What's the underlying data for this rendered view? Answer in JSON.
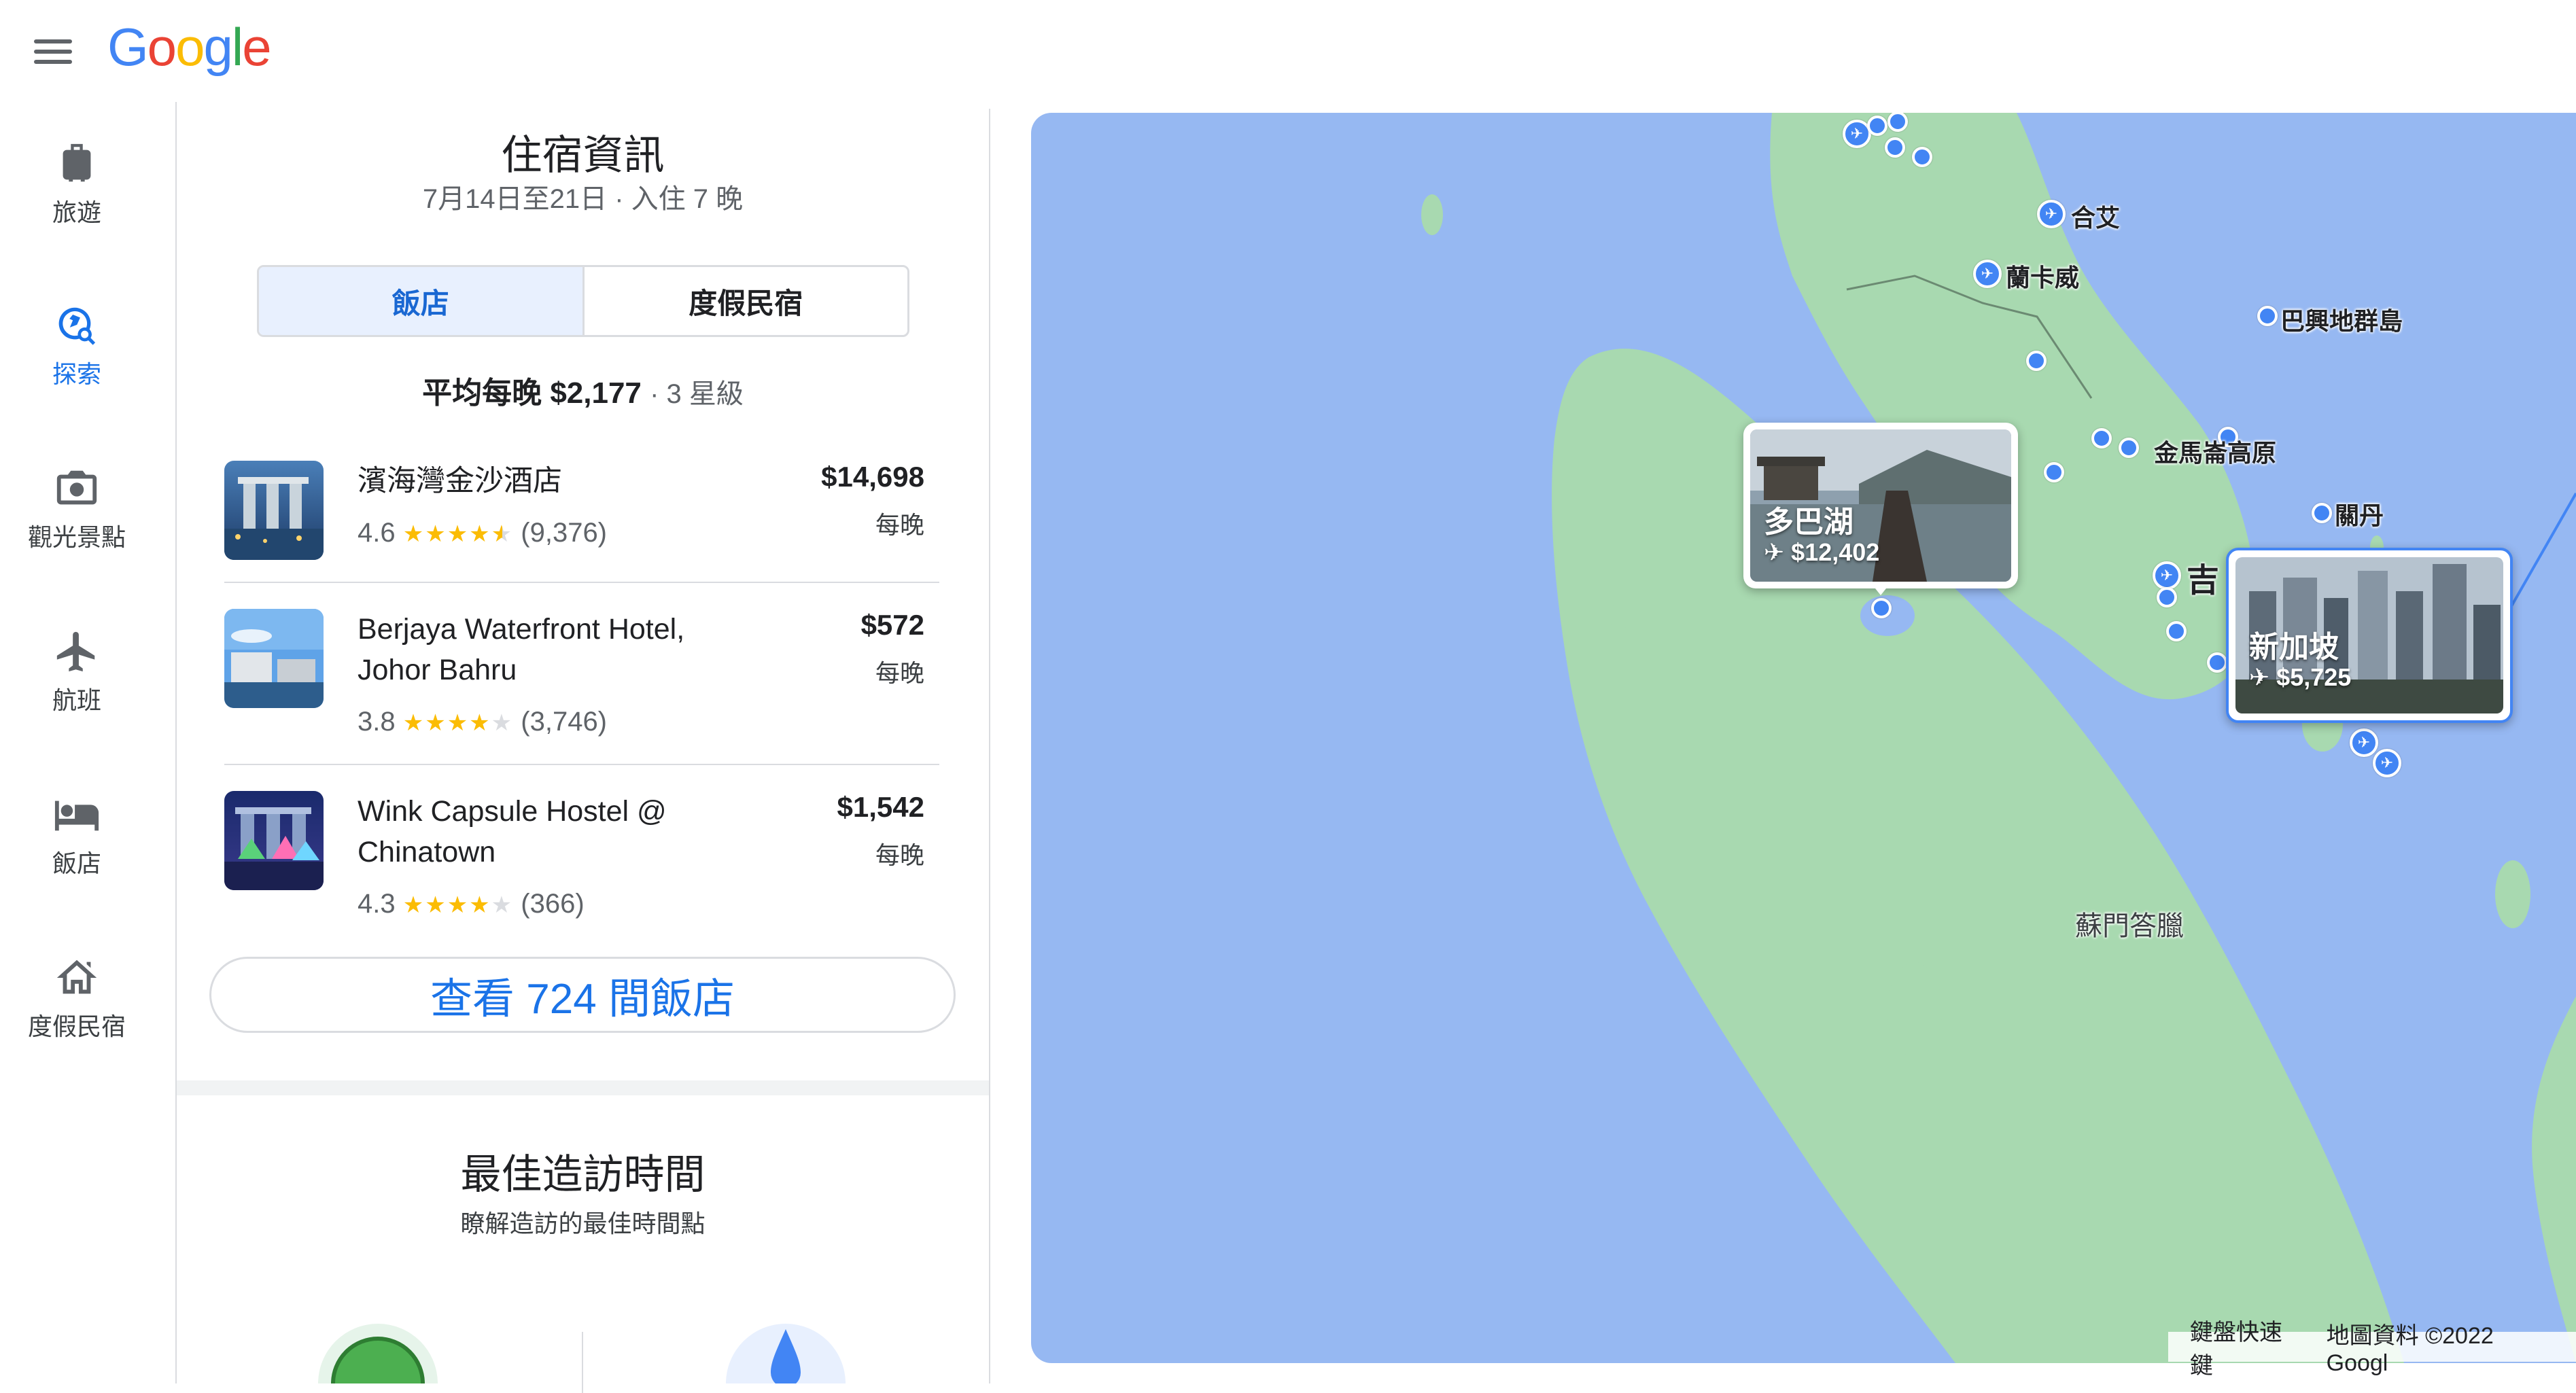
{
  "app": {
    "logo": "Google",
    "logo_colors": [
      "#4285F4",
      "#EA4335",
      "#FBBC05",
      "#4285F4",
      "#34A853",
      "#EA4335"
    ]
  },
  "nav": {
    "items": [
      {
        "label": "旅遊",
        "icon": "luggage-icon",
        "active": false
      },
      {
        "label": "探索",
        "icon": "explore-icon",
        "active": true
      },
      {
        "label": "觀光景點",
        "icon": "camera-icon",
        "active": false
      },
      {
        "label": "航班",
        "icon": "airplane-icon",
        "active": false
      },
      {
        "label": "飯店",
        "icon": "bed-icon",
        "active": false
      },
      {
        "label": "度假民宿",
        "icon": "house-icon",
        "active": false
      }
    ]
  },
  "lodging": {
    "title": "住宿資訊",
    "dates": "7月14日至21日 · 入住 7 晚",
    "tabs": [
      {
        "label": "飯店",
        "active": true
      },
      {
        "label": "度假民宿",
        "active": false
      }
    ],
    "avg_label": "平均每晚",
    "avg_price": "$2,177",
    "avg_class": "· 3 星級",
    "hotels": [
      {
        "name": "濱海灣金沙酒店",
        "rating": "4.6",
        "stars": 4.5,
        "reviews": "(9,376)",
        "price": "$14,698",
        "per": "每晚"
      },
      {
        "name": "Berjaya Waterfront Hotel, Johor Bahru",
        "rating": "3.8",
        "stars": 4,
        "reviews": "(3,746)",
        "price": "$572",
        "per": "每晚"
      },
      {
        "name": "Wink Capsule Hostel @ Chinatown",
        "rating": "4.3",
        "stars": 4,
        "reviews": "(366)",
        "price": "$1,542",
        "per": "每晚"
      }
    ],
    "view_all": "查看 724 間飯店"
  },
  "best_time": {
    "title": "最佳造訪時間",
    "subtitle": "瞭解造訪的最佳時間點"
  },
  "map": {
    "labels": [
      "合艾",
      "蘭卡威",
      "巴興地群島",
      "金馬崙高原",
      "關丹",
      "吉",
      "蘇門答臘"
    ],
    "cards": [
      {
        "name": "多巴湖",
        "price": "$12,402"
      },
      {
        "name": "新加坡",
        "price": "$5,725"
      }
    ],
    "attribution": [
      "鍵盤快速鍵",
      "地圖資料 ©2022 Googl"
    ]
  }
}
